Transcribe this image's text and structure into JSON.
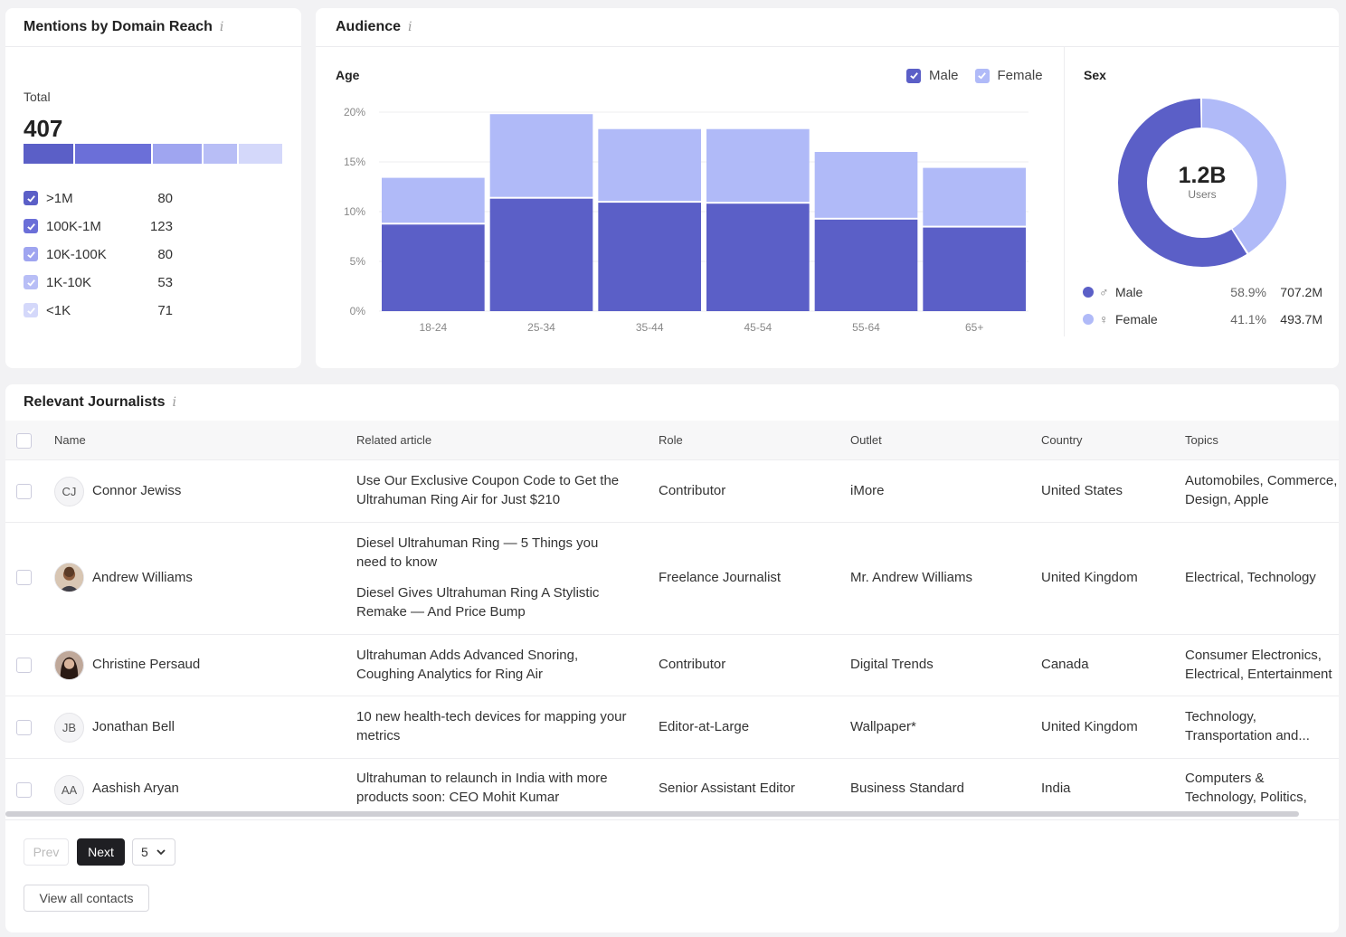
{
  "mentions": {
    "title": "Mentions by Domain Reach",
    "total_label": "Total",
    "total_value": "407",
    "segments": [
      {
        "label": ">1M",
        "count": "80",
        "value": 80,
        "color": "#5b5fc7"
      },
      {
        "label": "100K-1M",
        "count": "123",
        "value": 123,
        "color": "#6b6fd8"
      },
      {
        "label": "10K-100K",
        "count": "80",
        "value": 80,
        "color": "#9fa5f0"
      },
      {
        "label": "1K-10K",
        "count": "53",
        "value": 53,
        "color": "#b8bef6"
      },
      {
        "label": "<1K",
        "count": "71",
        "value": 71,
        "color": "#d4d8fa"
      }
    ]
  },
  "audience": {
    "title": "Audience",
    "age_title": "Age",
    "sex_title": "Sex",
    "legend_male": "Male",
    "legend_female": "Female",
    "donut_value": "1.2B",
    "donut_label": "Users",
    "male_color": "#5b5fc7",
    "female_color": "#b0baf8",
    "sex_rows": [
      {
        "label": "Male",
        "pct": "58.9%",
        "value": "707.2M",
        "share": 58.9
      },
      {
        "label": "Female",
        "pct": "41.1%",
        "value": "493.7M",
        "share": 41.1
      }
    ]
  },
  "chart_data": {
    "type": "bar",
    "stacked": true,
    "categories": [
      "18-24",
      "25-34",
      "35-44",
      "45-54",
      "55-64",
      "65+"
    ],
    "series": [
      {
        "name": "Male",
        "values": [
          8.7,
          11.3,
          10.9,
          10.8,
          9.2,
          8.4
        ]
      },
      {
        "name": "Female",
        "values": [
          4.7,
          8.5,
          7.4,
          7.5,
          6.8,
          6.0
        ]
      }
    ],
    "yticks": [
      "0%",
      "5%",
      "10%",
      "15%",
      "20%"
    ],
    "ylim": [
      0,
      20
    ],
    "grid": true,
    "legend": "top-right"
  },
  "journalists": {
    "title": "Relevant Journalists",
    "columns": {
      "name": "Name",
      "article": "Related article",
      "role": "Role",
      "outlet": "Outlet",
      "country": "Country",
      "topics": "Topics"
    },
    "rows": [
      {
        "initials": "CJ",
        "name": "Connor Jewiss",
        "articles": [
          "Use Our Exclusive Coupon Code to Get the Ultrahuman Ring Air for Just $210"
        ],
        "role": "Contributor",
        "outlet": "iMore",
        "country": "United States",
        "topics": "Automobiles, Commerce, Design, Apple Products,..."
      },
      {
        "initials": "",
        "name": "Andrew Williams",
        "articles": [
          "Diesel Ultrahuman Ring — 5 Things you need to know",
          "Diesel Gives Ultrahuman Ring A Stylistic Remake — And Price Bump"
        ],
        "role": "Freelance Journalist",
        "outlet": "Mr. Andrew Williams",
        "country": "United Kingdom",
        "topics": "Electrical, Technology"
      },
      {
        "initials": "",
        "name": "Christine Persaud",
        "articles": [
          "Ultrahuman Adds Advanced Snoring, Coughing Analytics for Ring Air"
        ],
        "role": "Contributor",
        "outlet": "Digital Trends",
        "country": "Canada",
        "topics": "Consumer Electronics, Electrical, Entertainment"
      },
      {
        "initials": "JB",
        "name": "Jonathan Bell",
        "articles": [
          "10 new health-tech devices for mapping your metrics"
        ],
        "role": "Editor-at-Large",
        "outlet": "Wallpaper*",
        "country": "United Kingdom",
        "topics": "Technology, Transportation and..."
      },
      {
        "initials": "AA",
        "name": "Aashish Aryan",
        "articles": [
          "Ultrahuman to relaunch in India with more products soon: CEO Mohit Kumar"
        ],
        "role": "Senior Assistant Editor",
        "outlet": "Business Standard",
        "country": "India",
        "topics": "Computers & Technology, Politics, Business"
      }
    ],
    "pagination": {
      "prev": "Prev",
      "next": "Next",
      "page_size": "5"
    },
    "view_all": "View all contacts"
  }
}
